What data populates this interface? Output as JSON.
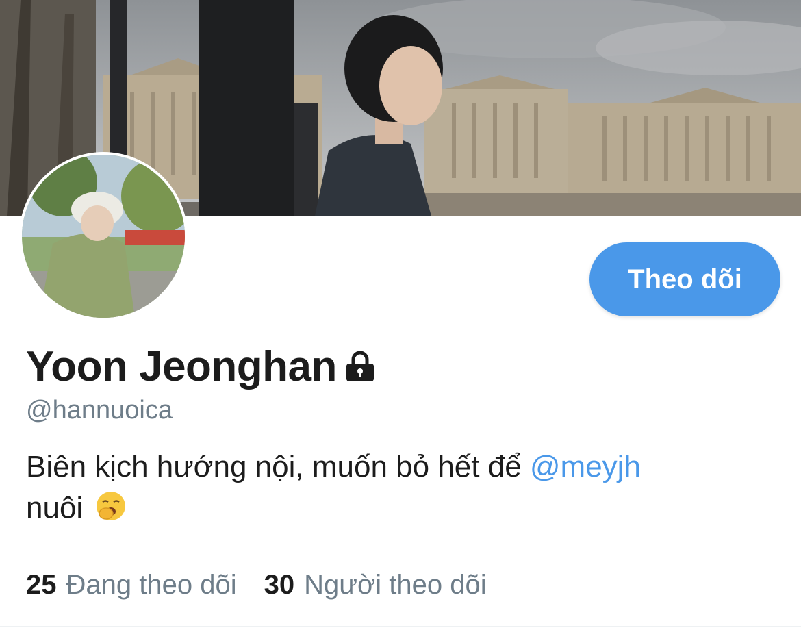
{
  "profile": {
    "display_name": "Yoon Jeonghan",
    "handle": "@hannuoica",
    "bio_text": "Biên kịch hướng nội, muốn bỏ hết để ",
    "bio_mention": "@meyjh",
    "bio_end": "nuôi",
    "bio_emoji": "yawning-face-emoji",
    "locked_icon": "lock-icon"
  },
  "actions": {
    "follow_label": "Theo dõi"
  },
  "stats": {
    "following_count": "25",
    "following_label": "Đang theo dõi",
    "followers_count": "30",
    "followers_label": "Người theo dõi"
  },
  "colors": {
    "accent": "#4a98e9",
    "secondary_text": "#6e7d89",
    "primary_text": "#1c1c1c"
  }
}
